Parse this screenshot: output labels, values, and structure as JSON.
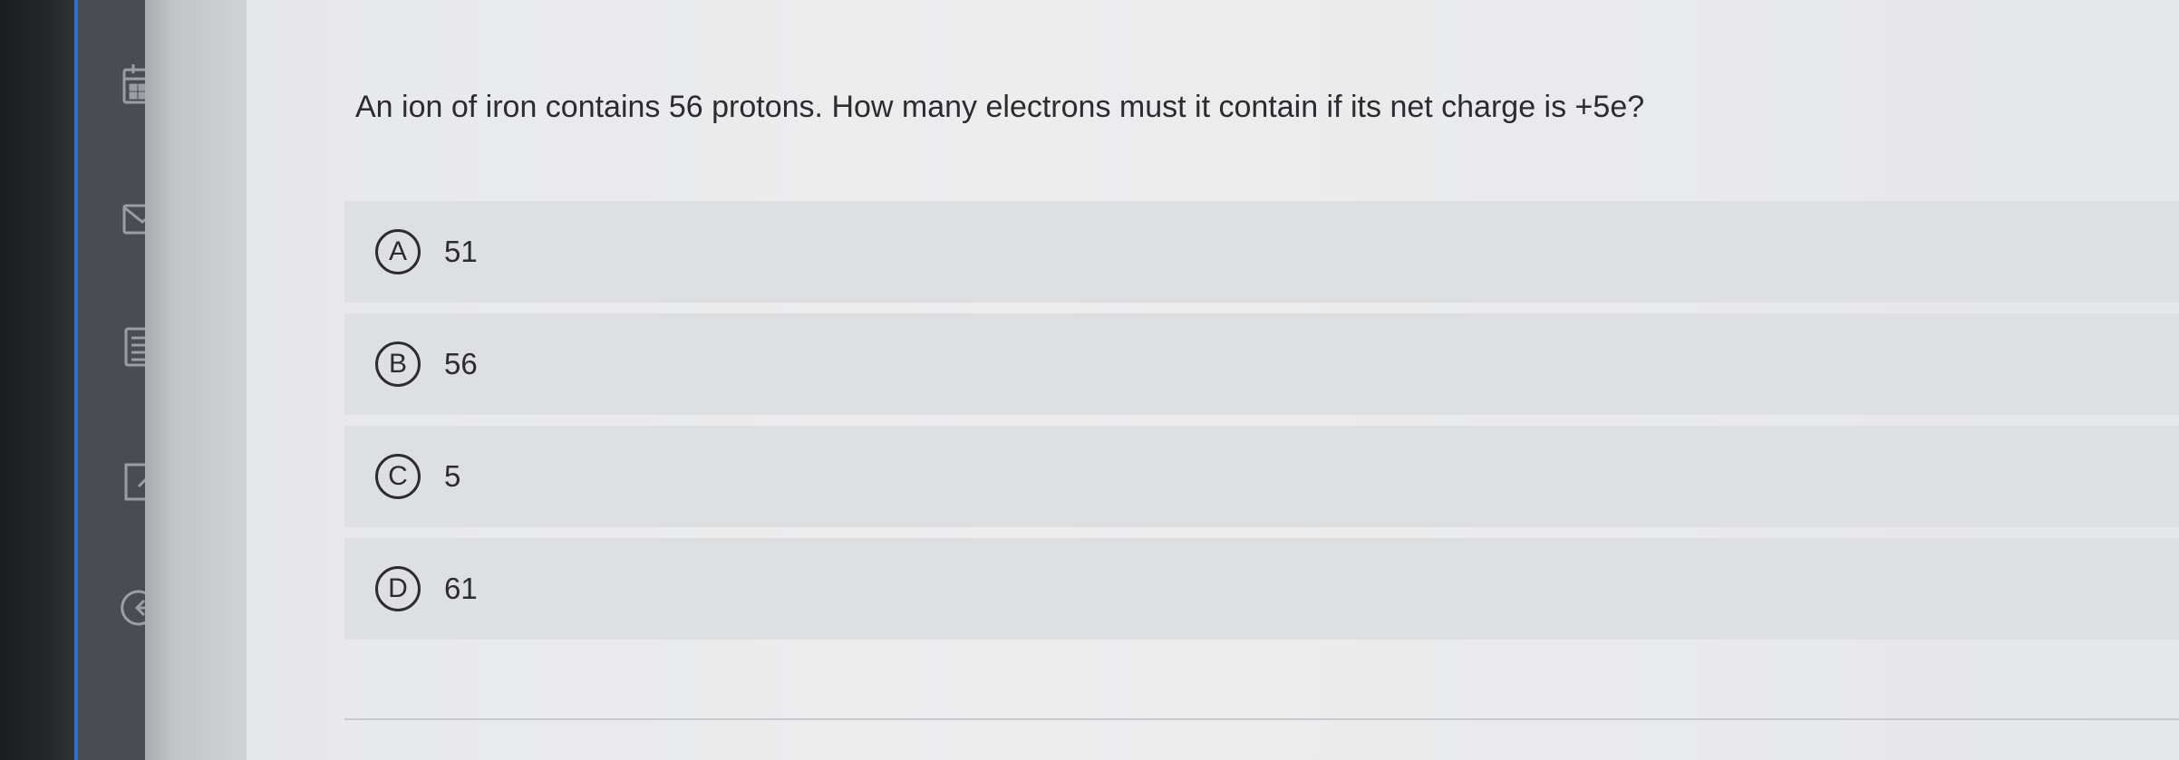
{
  "question": {
    "text": "An ion of iron contains 56 protons. How many electrons must it contain if its net charge is +5e?"
  },
  "options": [
    {
      "letter": "A",
      "value": "51"
    },
    {
      "letter": "B",
      "value": "56"
    },
    {
      "letter": "C",
      "value": "5"
    },
    {
      "letter": "D",
      "value": "61"
    }
  ],
  "sidebar": {
    "icons": [
      "calendar-icon",
      "mail-icon",
      "document-icon",
      "edit-icon",
      "logout-icon"
    ]
  }
}
